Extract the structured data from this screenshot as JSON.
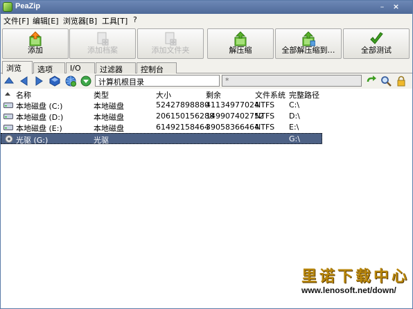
{
  "window": {
    "title": "PeaZip",
    "minimize": "–",
    "close": "×"
  },
  "menu": [
    {
      "label": "文件[F]"
    },
    {
      "label": "编辑[E]"
    },
    {
      "label": "浏览器[B]"
    },
    {
      "label": "工具[T]"
    },
    {
      "label": "?"
    }
  ],
  "toolbar": [
    {
      "label": "添加",
      "icon": "add-icon",
      "disabled": false
    },
    {
      "label": "添加档案",
      "icon": "add-archive-icon",
      "disabled": true
    },
    {
      "label": "添加文件夹",
      "icon": "add-folder-icon",
      "disabled": true
    },
    {
      "label": "解压缩",
      "icon": "extract-icon",
      "disabled": false
    },
    {
      "label": "全部解压缩到…",
      "icon": "extract-all-icon",
      "disabled": false
    },
    {
      "label": "全部测试",
      "icon": "test-all-icon",
      "disabled": false
    }
  ],
  "tabs": [
    {
      "label": "浏览"
    },
    {
      "label": "选项"
    },
    {
      "label": "I/O"
    },
    {
      "label": "过滤器"
    },
    {
      "label": "控制台"
    }
  ],
  "navbar": {
    "address": "计算机根目录",
    "filter": "*"
  },
  "columns": [
    "名称",
    "类型",
    "大小",
    "剩余",
    "文件系统",
    "完整路径"
  ],
  "rows": [
    {
      "name": "本地磁盘 (C:)",
      "type": "本地磁盘",
      "size": "52427898880",
      "free": "41134977024",
      "fs": "NTFS",
      "path": "C:\\",
      "icon": "hard-disk-icon"
    },
    {
      "name": "本地磁盘 (D:)",
      "type": "本地磁盘",
      "size": "206150156288",
      "free": "149907402752",
      "fs": "NTFS",
      "path": "D:\\",
      "icon": "hard-disk-icon"
    },
    {
      "name": "本地磁盘 (E:)",
      "type": "本地磁盘",
      "size": "61492158464",
      "free": "39058366464",
      "fs": "NTFS",
      "path": "E:\\",
      "icon": "hard-disk-icon"
    },
    {
      "name": "光驱 (G:)",
      "type": "光驱",
      "size": "",
      "free": "",
      "fs": "",
      "path": "G:\\",
      "icon": "cd-drive-icon"
    }
  ],
  "watermark": {
    "text": "里诺下载中心",
    "url": "www.lenosoft.net/down/"
  },
  "colors": {
    "titlebar": "#5c78a8",
    "selection": "#4d6185",
    "accent_green": "#3f9e22"
  }
}
